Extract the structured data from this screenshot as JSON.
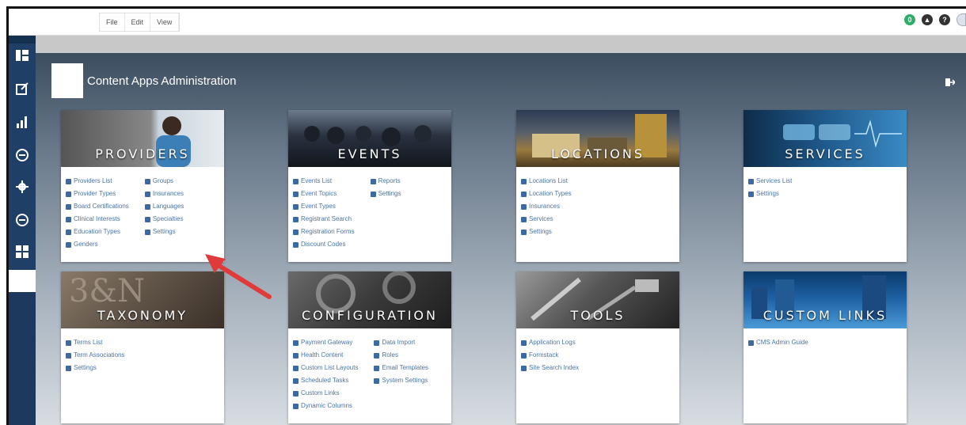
{
  "menu": [
    "File",
    "Edit",
    "View"
  ],
  "top_icons": [
    {
      "name": "status-icon",
      "glyph": "0",
      "color": "#2eae6a"
    },
    {
      "name": "cloud-upload-icon",
      "glyph": "▲",
      "color": "#333333"
    },
    {
      "name": "help-icon",
      "glyph": "?",
      "color": "#333333"
    }
  ],
  "app": {
    "title": "Content Apps Administration"
  },
  "cards": [
    {
      "title": "PROVIDERS",
      "links": [
        [
          "Providers List",
          "Provider Types",
          "Board Certifications",
          "Clinical Interests",
          "Education Types",
          "Genders"
        ],
        [
          "Groups",
          "Insurances",
          "Languages",
          "Specialties",
          "Settings"
        ]
      ]
    },
    {
      "title": "EVENTS",
      "links": [
        [
          "Events List",
          "Event Topics",
          "Event Types",
          "Registrant Search",
          "Registration Forms",
          "Discount Codes"
        ],
        [
          "Reports",
          "Settings"
        ]
      ]
    },
    {
      "title": "LOCATIONS",
      "links": [
        [
          "Locations List",
          "Location Types",
          "Insurances",
          "Services",
          "Settings"
        ]
      ]
    },
    {
      "title": "SERVICES",
      "links": [
        [
          "Services List",
          "Settings"
        ]
      ]
    },
    {
      "title": "TAXONOMY",
      "links": [
        [
          "Terms List",
          "Term Associations",
          "Settings"
        ]
      ]
    },
    {
      "title": "CONFIGURATION",
      "links": [
        [
          "Payment Gateway",
          "Health Content",
          "Custom List Layouts",
          "Scheduled Tasks",
          "Custom Links",
          "Dynamic Columns"
        ],
        [
          "Data Import",
          "Roles",
          "Email Templates",
          "System Settings"
        ]
      ]
    },
    {
      "title": "TOOLS",
      "links": [
        [
          "Application Logs",
          "Formstack",
          "Site Search Index"
        ]
      ]
    },
    {
      "title": "CUSTOM LINKS",
      "links": [
        [
          "CMS Admin Guide"
        ]
      ]
    }
  ],
  "colors": {
    "sidebar": "#1f3f67",
    "link": "#4a74a8",
    "arrow": "#e03b3b"
  }
}
